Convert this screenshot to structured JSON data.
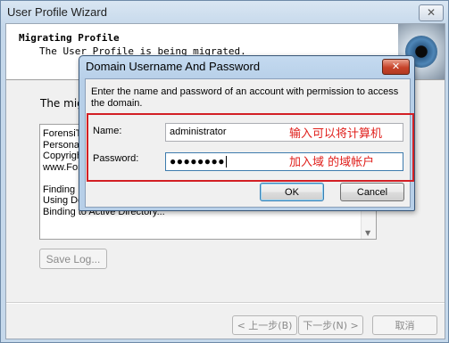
{
  "wizard": {
    "title": "User Profile Wizard",
    "close_glyph": "✕",
    "header_title": "Migrating Profile",
    "header_subtitle": "The User Profile is being migrated.",
    "status_text": "The migra",
    "log_lines": [
      "ForensiT",
      "Personal",
      "Copyrigh",
      "www.For",
      "",
      "Finding D",
      "Using Do",
      "Binding to Active Directory..."
    ],
    "save_log_label": "Save Log...",
    "back_label": "< 上一步(B)",
    "next_label": "下一步(N) >",
    "cancel_label": "取消"
  },
  "dialog": {
    "title": "Domain Username And Password",
    "close_glyph": "✕",
    "description": "Enter the name and password of an account with permission to access the domain.",
    "name_label": "Name:",
    "name_value": "administrator",
    "password_label": "Password:",
    "password_value": "●●●●●●●●",
    "annotation_name": "输入可以将计算机",
    "annotation_password": "加入域 的域帐户",
    "ok_label": "OK",
    "cancel_label": "Cancel"
  },
  "colors": {
    "annotation_red": "#e0201c",
    "highlight_border": "#d31f25",
    "dialog_frame": "#b7cfe8"
  }
}
